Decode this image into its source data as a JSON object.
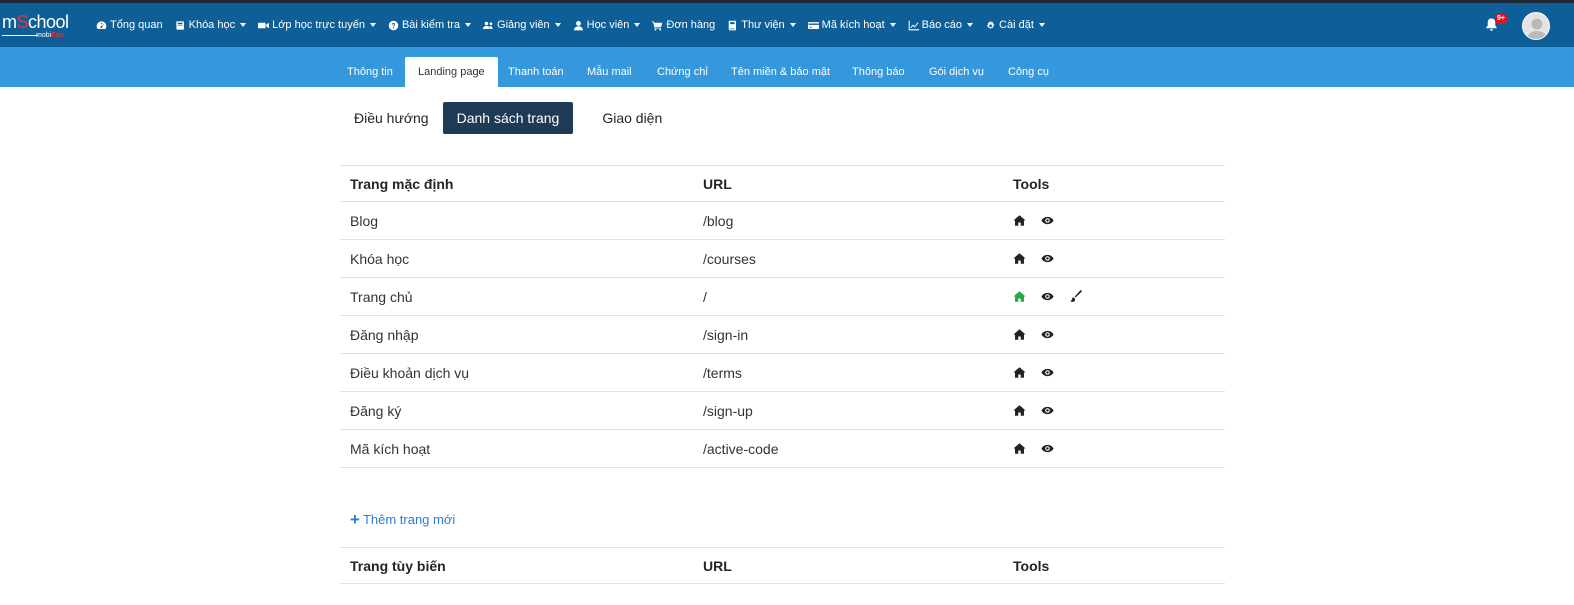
{
  "brand": {
    "logo_text_a": "m",
    "logo_text_b": "S",
    "logo_text_c": "chool",
    "logo_sub_a": "mobi",
    "logo_sub_b": "Edu"
  },
  "nav": [
    {
      "label": "Tổng quan",
      "icon": "dashboard-icon",
      "caret": false
    },
    {
      "label": "Khóa học",
      "icon": "book-icon",
      "caret": true
    },
    {
      "label": "Lớp học trực tuyến",
      "icon": "video-icon",
      "caret": true
    },
    {
      "label": "Bài kiểm tra",
      "icon": "question-circle-icon",
      "caret": true
    },
    {
      "label": "Giảng viên",
      "icon": "users-icon",
      "caret": true
    },
    {
      "label": "Học viên",
      "icon": "user-icon",
      "caret": true
    },
    {
      "label": "Đơn hàng",
      "icon": "cart-icon",
      "caret": false
    },
    {
      "label": "Thư viện",
      "icon": "library-icon",
      "caret": true
    },
    {
      "label": "Mã kích hoạt",
      "icon": "card-icon",
      "caret": true
    },
    {
      "label": "Báo cáo",
      "icon": "chart-icon",
      "caret": true
    },
    {
      "label": "Cài đặt",
      "icon": "cogs-icon",
      "caret": true
    }
  ],
  "notifications": {
    "badge": "9+"
  },
  "subtabs": [
    "Thông tin",
    "Landing page",
    "Thanh toán",
    "Mẫu mail",
    "Chứng chỉ",
    "Tên miền & bảo mật",
    "Thông báo",
    "Gói dịch vụ",
    "Công cụ"
  ],
  "active_subtab": "Landing page",
  "pills": {
    "nav": "Điều hướng",
    "pages": "Danh sách trang",
    "theme": "Giao diện"
  },
  "default_table": {
    "headers": {
      "name": "Trang mặc định",
      "url": "URL",
      "tools": "Tools"
    },
    "rows": [
      {
        "name": "Blog",
        "url": "/blog",
        "home_active": false,
        "edit": false
      },
      {
        "name": "Khóa học",
        "url": "/courses",
        "home_active": false,
        "edit": false
      },
      {
        "name": "Trang chủ",
        "url": "/",
        "home_active": true,
        "edit": true
      },
      {
        "name": "Đăng nhập",
        "url": "/sign-in",
        "home_active": false,
        "edit": false
      },
      {
        "name": "Điều khoản dịch vụ",
        "url": "/terms",
        "home_active": false,
        "edit": false
      },
      {
        "name": "Đăng ký",
        "url": "/sign-up",
        "home_active": false,
        "edit": false
      },
      {
        "name": "Mã kích hoạt",
        "url": "/active-code",
        "home_active": false,
        "edit": false
      }
    ]
  },
  "add_page": {
    "plus": "+",
    "label": "Thêm trang mới"
  },
  "custom_table": {
    "headers": {
      "name": "Trang tùy biến",
      "url": "URL",
      "tools": "Tools"
    }
  },
  "colors": {
    "topbar": "#0e5f98",
    "subbar": "#3597dc",
    "active_pill": "#1e3a55",
    "home_active": "#28a745",
    "link": "#2a7fd6"
  }
}
